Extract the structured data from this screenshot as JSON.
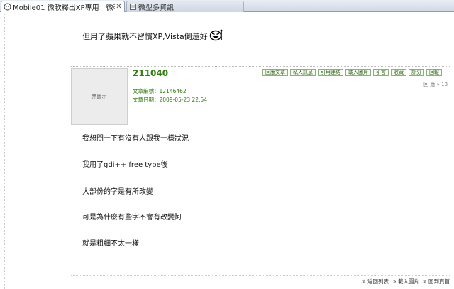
{
  "tabs": [
    {
      "title": "Mobile01 微軟釋出XP專用「微軟...",
      "active": true,
      "icon": "mobile01-icon"
    },
    {
      "title": "微型多資訊",
      "active": false,
      "icon": "page-icon"
    }
  ],
  "previous_post": {
    "text": "但用了蘋果就不習慣XP,Vista倒還好",
    "emoticon": "grinning-face-icon"
  },
  "post": {
    "username": "211040",
    "avatar_placeholder": "無圖示",
    "post_no_label": "文章編號：12146462",
    "post_date_label": "文章日期：2009-05-23 22:54",
    "page_indicator": "回 應 » 18",
    "actions": [
      "回應文章",
      "私人訊息",
      "引用連結",
      "載入圖片",
      "引言",
      "收藏",
      "評分",
      "回報"
    ],
    "content": [
      "我想問一下有沒有人跟我一樣狀況",
      "我用了gdi++ free type後",
      "大部份的字是有所改變",
      "可是為什麼有些字不會有改變阿",
      "就是粗細不太一樣"
    ]
  },
  "footer_links": [
    "» 返回列表",
    "» 載入圖片",
    "» 回到頁首"
  ],
  "colors": {
    "accent_green": "#2f7d0f",
    "button_border": "#8fae7d"
  }
}
